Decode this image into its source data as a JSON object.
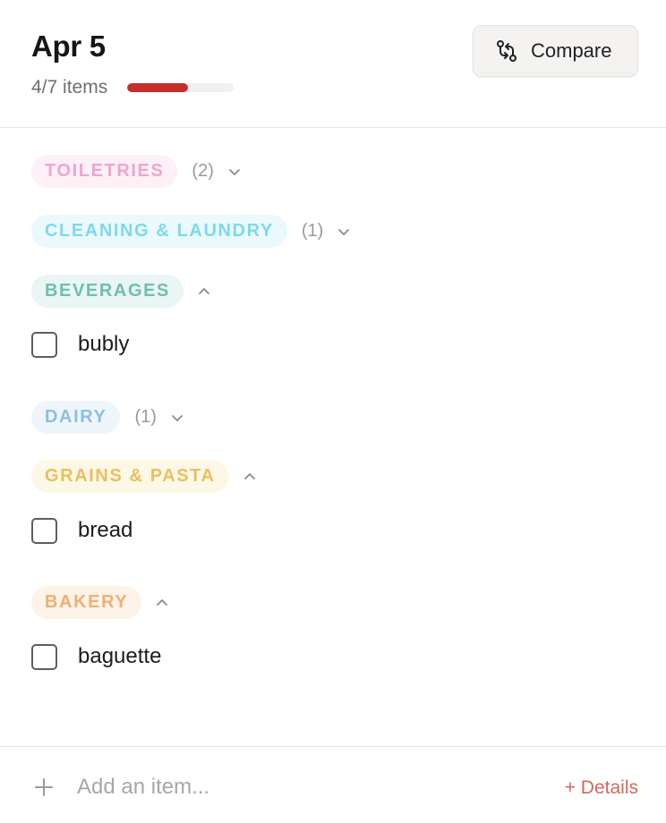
{
  "header": {
    "title": "Apr 5",
    "count_text": "4/7 items",
    "progress": 0.57,
    "progress_color": "#c3302b",
    "compare_label": "Compare",
    "compare_icon": "compare-arrows-icon"
  },
  "categories": [
    {
      "label": "TOILETRIES",
      "count": "(2)",
      "expanded": false,
      "text_color": "#eea6cf",
      "bg_color": "#fdf0f6",
      "items": []
    },
    {
      "label": "CLEANING & LAUNDRY",
      "count": "(1)",
      "expanded": false,
      "text_color": "#7fd9ea",
      "bg_color": "#ecf9fc",
      "items": []
    },
    {
      "label": "BEVERAGES",
      "count": "",
      "expanded": true,
      "text_color": "#6fbfad",
      "bg_color": "#eaf6f3",
      "items": [
        {
          "label": "bubly",
          "checked": false
        }
      ]
    },
    {
      "label": "DAIRY",
      "count": "(1)",
      "expanded": false,
      "text_color": "#8cc0e0",
      "bg_color": "#eef6fb",
      "items": []
    },
    {
      "label": "GRAINS & PASTA",
      "count": "",
      "expanded": true,
      "text_color": "#e6c160",
      "bg_color": "#fdf7e6",
      "items": [
        {
          "label": "bread",
          "checked": false
        }
      ]
    },
    {
      "label": "BAKERY",
      "count": "",
      "expanded": true,
      "text_color": "#efb073",
      "bg_color": "#fdf3e9",
      "items": [
        {
          "label": "baguette",
          "checked": false
        }
      ]
    }
  ],
  "footer": {
    "add_placeholder": "Add an item...",
    "add_value": "",
    "details_label": "+ Details",
    "plus_icon": "plus-icon"
  }
}
